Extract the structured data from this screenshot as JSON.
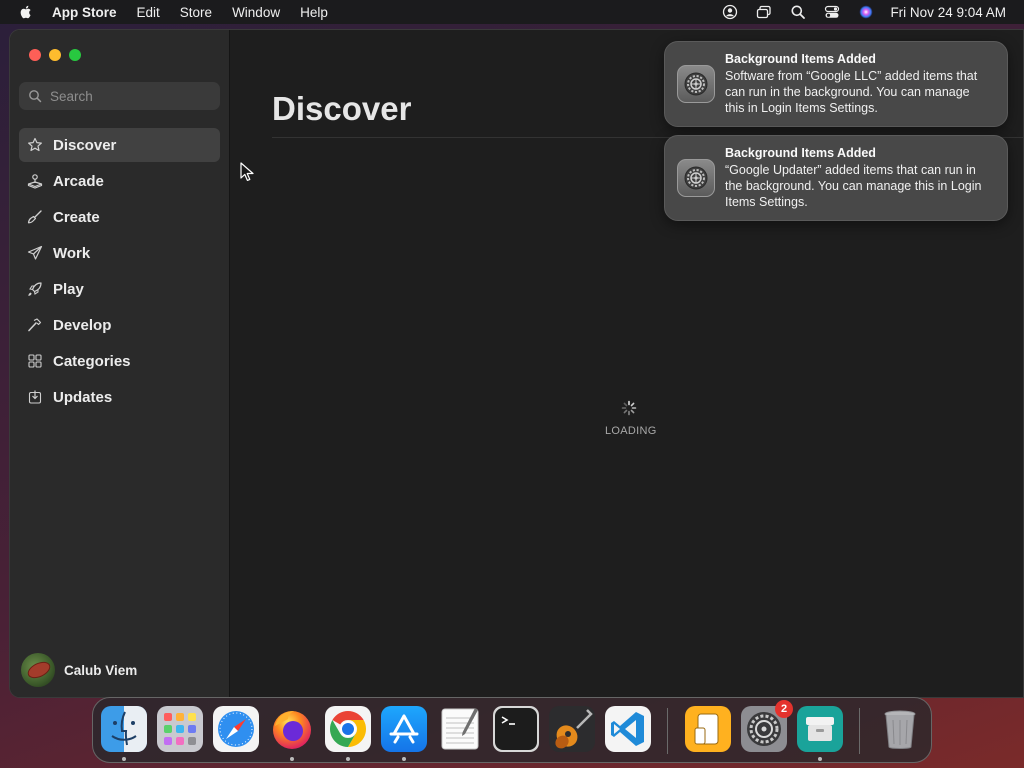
{
  "menubar": {
    "app_name": "App Store",
    "menus": [
      "Edit",
      "Store",
      "Window",
      "Help"
    ],
    "clock": "Fri Nov 24  9:04 AM"
  },
  "sidebar": {
    "search_placeholder": "Search",
    "items": [
      {
        "label": "Discover",
        "icon": "star-icon",
        "active": true
      },
      {
        "label": "Arcade",
        "icon": "joystick-icon"
      },
      {
        "label": "Create",
        "icon": "brush-icon"
      },
      {
        "label": "Work",
        "icon": "paper-plane-icon"
      },
      {
        "label": "Play",
        "icon": "rocket-icon"
      },
      {
        "label": "Develop",
        "icon": "hammer-icon"
      },
      {
        "label": "Categories",
        "icon": "grid-icon"
      },
      {
        "label": "Updates",
        "icon": "download-tray-icon"
      }
    ],
    "account_name": "Calub Viem"
  },
  "main": {
    "title": "Discover",
    "loading_label": "LOADING"
  },
  "notifications": [
    {
      "title": "Background Items Added",
      "body": "Software from “Google LLC” added items that can run in the background. You can manage this in Login Items Settings."
    },
    {
      "title": "Background Items Added",
      "body": "“Google Updater” added items that can run in the background. You can manage this in Login Items Settings."
    }
  ],
  "dock": {
    "apps": [
      "Finder",
      "Launchpad",
      "Safari",
      "Firefox",
      "Google Chrome",
      "App Store",
      "TextEdit",
      "Terminal",
      "GarageBand",
      "Visual Studio Code",
      "Preview",
      "System Settings",
      "Archive Utility",
      "Trash"
    ],
    "system_settings_badge": "2"
  },
  "colors": {
    "accent_close": "#fe5f57",
    "accent_minimize": "#febc2e",
    "accent_zoom": "#28c840",
    "badge": "#e5322d"
  }
}
